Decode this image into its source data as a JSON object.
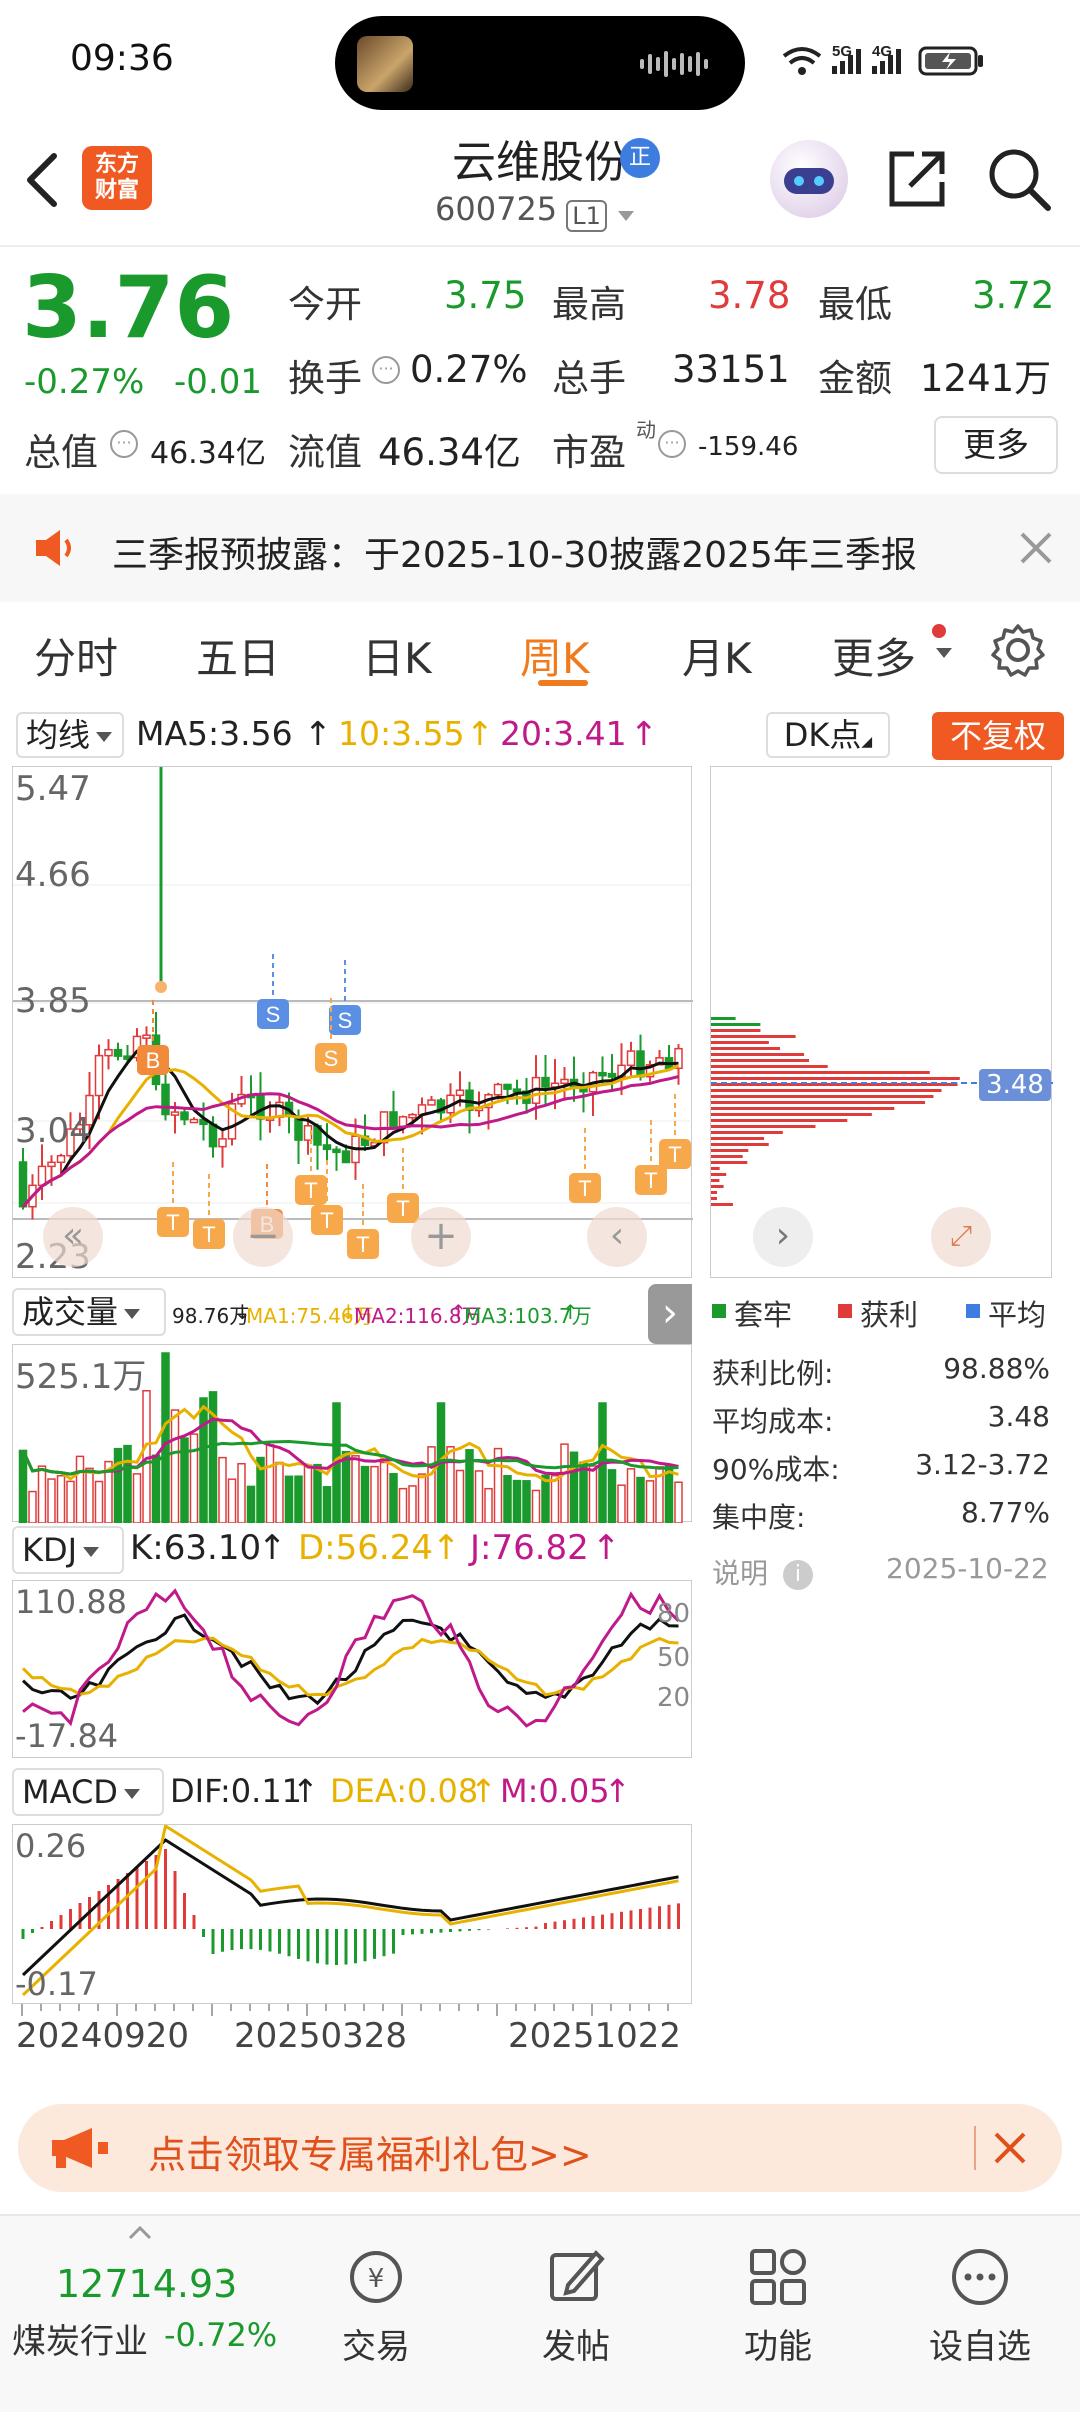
{
  "status_bar": {
    "time": "09:36",
    "signal_5g": "5G",
    "signal_4g": "4G"
  },
  "header": {
    "app_logo_line1": "东方",
    "app_logo_line2": "财富",
    "title": "云维股份",
    "title_badge": "正",
    "code": "600725",
    "level": "L1"
  },
  "quote": {
    "price": "3.76",
    "change_pct": "-0.27%",
    "change": "-0.01",
    "open_label": "今开",
    "open": "3.75",
    "high_label": "最高",
    "high": "3.78",
    "low_label": "最低",
    "low": "3.72",
    "turnover_label": "换手",
    "turnover": "0.27%",
    "volume_label": "总手",
    "volume": "33151",
    "amount_label": "金额",
    "amount": "1241万",
    "total_cap_label": "总值",
    "total_cap": "46.34亿",
    "float_cap_label": "流值",
    "float_cap": "46.34亿",
    "pe_label": "市盈",
    "pe_sup": "动",
    "pe": "-159.46",
    "more": "更多"
  },
  "notice": {
    "text": "三季报预披露：于2025-10-30披露2025年三季报"
  },
  "tabs": [
    "分时",
    "五日",
    "日K",
    "周K",
    "月K",
    "更多"
  ],
  "active_tab": "周K",
  "ma_bar": {
    "selector": "均线",
    "ma5": "MA5:3.56",
    "ma10": "10:3.55",
    "ma20": "20:3.41",
    "dk": "DK点",
    "adjust": "不复权"
  },
  "kline": {
    "y_labels": [
      "5.47",
      "4.66",
      "3.85",
      "3.04",
      "2.23"
    ],
    "markers": [
      "B",
      "B",
      "S",
      "S",
      "T"
    ]
  },
  "volume_bar": {
    "selector": "成交量",
    "vol": "98.76万",
    "ma1": "MA1:75.46万",
    "ma2": "MA2:116.8万",
    "ma3": "MA3:103.7万",
    "y_label": "525.1万"
  },
  "kdj_bar": {
    "selector": "KDJ",
    "k": "K:63.10",
    "d": "D:56.24",
    "j": "J:76.82",
    "y_top": "110.88",
    "y_bottom": "-17.84",
    "r80": "80",
    "r50": "50",
    "r20": "20"
  },
  "macd_bar": {
    "selector": "MACD",
    "dif": "DIF:0.11",
    "dea": "DEA:0.08",
    "m": "M:0.05",
    "y_top": "0.26",
    "y_bottom": "-0.17"
  },
  "x_dates": [
    "20240920",
    "20250328",
    "20251022"
  ],
  "chip": {
    "price_tag": "3.48",
    "legend": [
      "套牢",
      "获利",
      "平均"
    ],
    "rows": [
      {
        "label": "获利比例:",
        "value": "98.88%"
      },
      {
        "label": "平均成本:",
        "value": "3.48"
      },
      {
        "label": "90%成本:",
        "value": "3.12-3.72"
      },
      {
        "label": "集中度:",
        "value": "8.77%"
      }
    ],
    "note_label": "说明",
    "note_date": "2025-10-22"
  },
  "promo": {
    "text": "点击领取专属福利礼包>>"
  },
  "bottom": {
    "index_value": "12714.93",
    "index_name": "煤炭行业",
    "index_change": "-0.72%",
    "items": [
      "交易",
      "发帖",
      "功能",
      "设自选"
    ]
  },
  "colors": {
    "red": "#e03b3b",
    "green": "#1a9a2c",
    "orange": "#f07a1c",
    "ma10": "#e8b100",
    "ma20": "#c0198a"
  }
}
